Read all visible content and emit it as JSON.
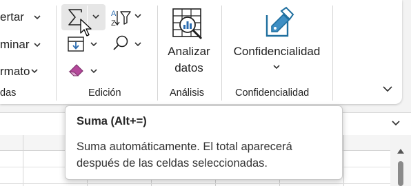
{
  "ribbon": {
    "left_group": {
      "row1_label": "ertar",
      "row2_label": "minar",
      "row3_label": "rmato",
      "group_label": "das"
    },
    "edicion": {
      "group_label": "Edición",
      "autosum_icon": "sigma-icon",
      "sort_filter_icon": "sort-filter-icon",
      "fill_icon": "fill-down-icon",
      "find_icon": "magnifier-icon",
      "clear_icon": "eraser-icon"
    },
    "analisis": {
      "button_line1": "Analizar",
      "button_line2": "datos",
      "group_label": "Análisis",
      "icon": "analyze-data-icon"
    },
    "confidencialidad": {
      "button_label": "Confidencialidad",
      "group_label": "Confidencialidad",
      "icon": "sensitivity-tag-icon"
    },
    "collapse_icon": "chevron-down-icon"
  },
  "tooltip": {
    "title": "Suma (Alt+=)",
    "desc_line1": "Suma automáticamente. El total aparecerá",
    "desc_line2": "después de las celdas seleccionadas."
  },
  "colors": {
    "accent_blue": "#2b6cb0",
    "icon_teal": "#1f6f9f",
    "eraser_pink": "#b4489a",
    "ribbon_bg": "#ffffff",
    "window_bg": "#f3f3f3"
  }
}
